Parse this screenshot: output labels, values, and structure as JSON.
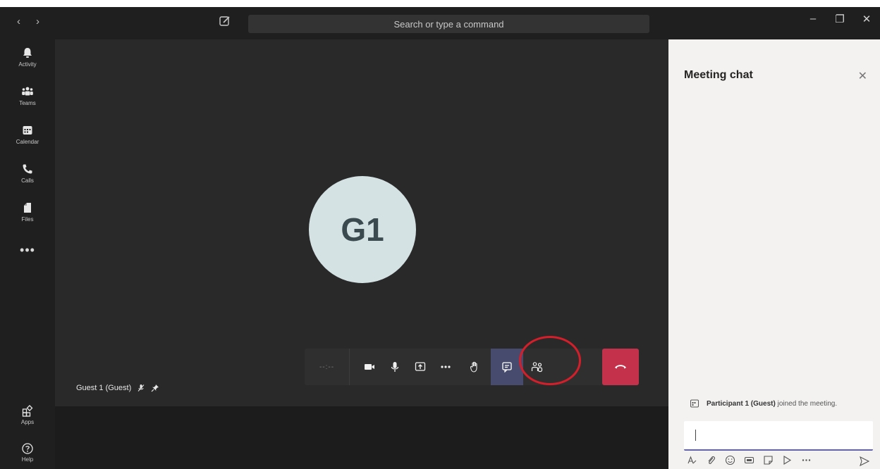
{
  "topbar": {
    "back": "‹",
    "forward": "›",
    "search_placeholder": "Search or type a command",
    "minimize": "–",
    "restore": "❐",
    "close": "✕"
  },
  "rail": {
    "items": [
      {
        "label": "Activity",
        "icon": "bell-icon"
      },
      {
        "label": "Teams",
        "icon": "teams-icon"
      },
      {
        "label": "Calendar",
        "icon": "calendar-icon"
      },
      {
        "label": "Calls",
        "icon": "phone-icon"
      },
      {
        "label": "Files",
        "icon": "file-icon"
      }
    ],
    "more": "•••",
    "apps_label": "Apps",
    "help_label": "Help"
  },
  "stage": {
    "avatar_initials": "G1",
    "participant_name": "Guest 1 (Guest)",
    "timer": "--:--"
  },
  "chat": {
    "title": "Meeting chat",
    "close": "✕",
    "system_message": {
      "name": "Participant 1 (Guest)",
      "text": " joined the meeting."
    }
  },
  "colors": {
    "accent": "#6264a7",
    "hangup": "#c4314b",
    "highlight": "#d41f2a"
  }
}
